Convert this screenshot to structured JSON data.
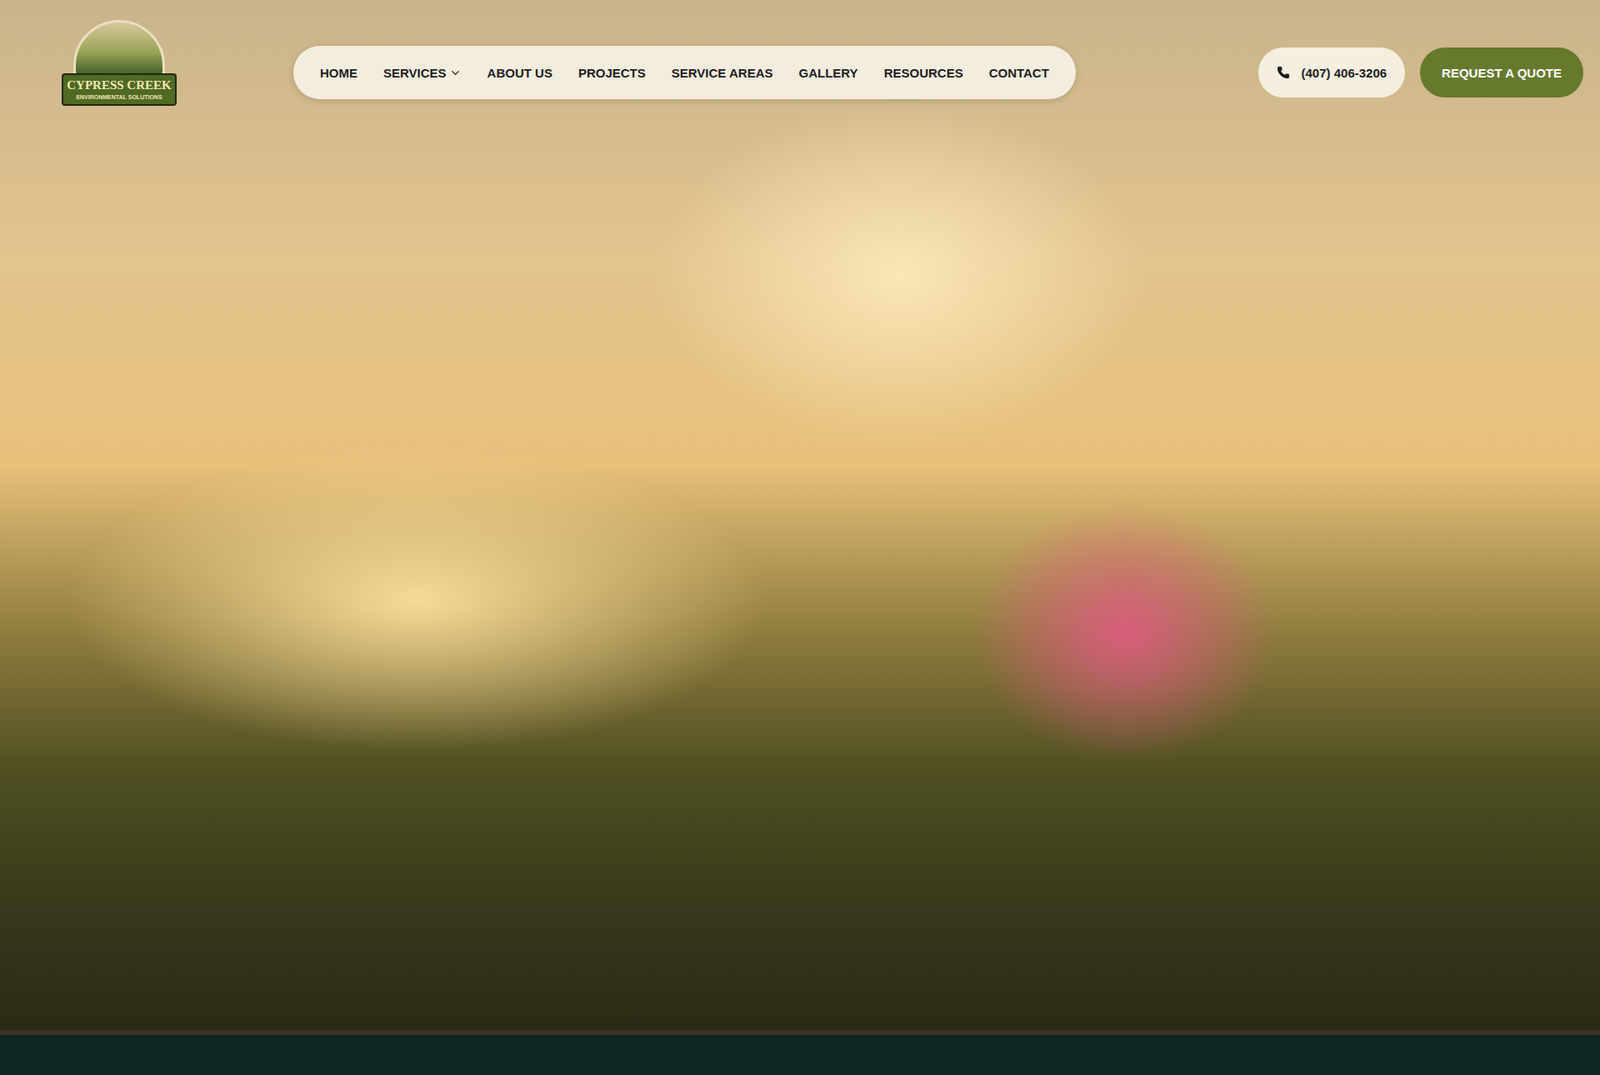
{
  "logo": {
    "name": "CYPRESS CREEK",
    "subtitle": "ENVIRONMENTAL SOLUTIONS"
  },
  "nav": {
    "items": [
      {
        "label": "HOME",
        "selected": false,
        "hasDropdown": false
      },
      {
        "label": "SERVICES",
        "selected": false,
        "hasDropdown": true
      },
      {
        "label": "ABOUT US",
        "selected": false,
        "hasDropdown": false
      },
      {
        "label": "PROJECTS",
        "selected": false,
        "hasDropdown": false
      },
      {
        "label": "SERVICE AREAS",
        "selected": false,
        "hasDropdown": false
      },
      {
        "label": "GALLERY",
        "selected": false,
        "hasDropdown": false
      },
      {
        "label": "RESOURCES",
        "selected": false,
        "hasDropdown": false
      },
      {
        "label": "CONTACT",
        "selected": false,
        "hasDropdown": false
      }
    ]
  },
  "phone": {
    "label": "(407) 406-3206"
  },
  "cta": {
    "label": "REQUEST A QUOTE"
  }
}
